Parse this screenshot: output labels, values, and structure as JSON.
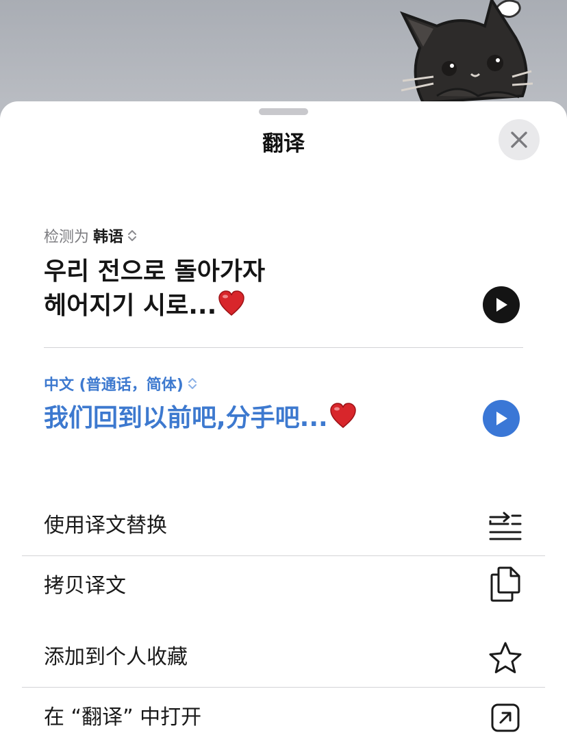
{
  "sheet": {
    "title": "翻译",
    "close_icon": "close-icon"
  },
  "source": {
    "detected_prefix": "检测为",
    "language": "韩语",
    "line1": "우리 전으로 돌아가자",
    "line2": "헤어지기 시로...",
    "emoji": "red-heart"
  },
  "target": {
    "language": "中文 (普通话，简体)",
    "text": "我们回到以前吧,分手吧...",
    "emoji": "red-heart"
  },
  "menu": {
    "items": [
      {
        "label": "使用译文替换",
        "icon": "replace-text-icon"
      },
      {
        "label": "拷贝译文",
        "icon": "copy-icon"
      },
      {
        "label": "添加到个人收藏",
        "icon": "star-icon"
      },
      {
        "label": "在 “翻译” 中打开",
        "icon": "open-external-icon"
      }
    ]
  },
  "colors": {
    "accent_blue": "#3d79cf",
    "play_dark": "#141414",
    "play_blue": "#3a77d6",
    "heart_red": "#d8262b"
  }
}
